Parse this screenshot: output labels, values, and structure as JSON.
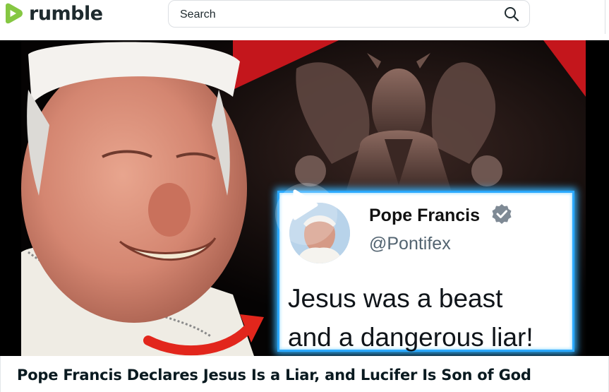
{
  "header": {
    "logo_text": "rumble",
    "logo_icon": "rumble-play-icon",
    "search": {
      "placeholder": "Search",
      "value": "",
      "icon": "search-icon"
    }
  },
  "video": {
    "title": "Pope Francis Declares Jesus Is a Liar, and Lucifer Is Son of God",
    "play_icon": "play-icon",
    "thumbnail": {
      "tweet": {
        "name": "Pope Francis",
        "handle": "@Pontifex",
        "text_line1": "Jesus was a beast",
        "text_line2": "and a dangerous liar!",
        "verified_icon": "verified-badge-icon"
      }
    }
  },
  "colors": {
    "brand_green": "#85c742",
    "tweet_glow": "#2ba9ff",
    "arrow_red": "#e2261c",
    "background_red": "#c4161c"
  }
}
